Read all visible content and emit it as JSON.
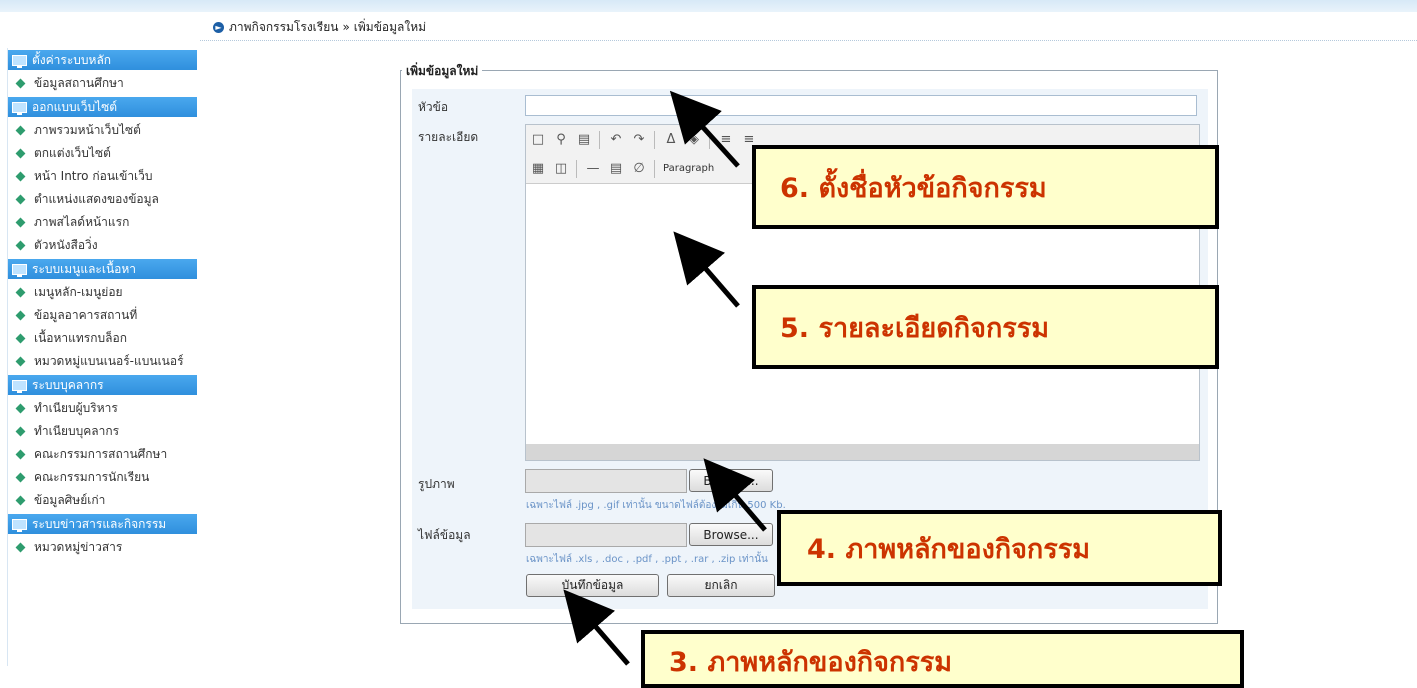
{
  "breadcrumb": {
    "section": "ภาพกิจกรรมโรงเรียน",
    "separator": "»",
    "page": "เพิ่มข้อมูลใหม่"
  },
  "sidebar": {
    "groups": [
      {
        "title": "ตั้งค่าระบบหลัก",
        "items": [
          "ข้อมูลสถานศึกษา"
        ]
      },
      {
        "title": "ออกแบบเว็บไซต์",
        "items": [
          "ภาพรวมหน้าเว็บไซต์",
          "ตกแต่งเว็บไซต์",
          "หน้า Intro ก่อนเข้าเว็บ",
          "ตำแหน่งแสดงของข้อมูล",
          "ภาพสไลด์หน้าแรก",
          "ตัวหนังสือวิ่ง"
        ]
      },
      {
        "title": "ระบบเมนูและเนื้อหา",
        "items": [
          "เมนูหลัก-เมนูย่อย",
          "ข้อมูลอาคารสถานที่",
          "เนื้อหาแทรกบล็อก",
          "หมวดหมู่แบนเนอร์-แบนเนอร์"
        ]
      },
      {
        "title": "ระบบบุคลากร",
        "items": [
          "ทำเนียบผู้บริหาร",
          "ทำเนียบบุคลากร",
          "คณะกรรมการสถานศึกษา",
          "คณะกรรมการนักเรียน",
          "ข้อมูลศิษย์เก่า"
        ]
      },
      {
        "title": "ระบบข่าวสารและกิจกรรม",
        "items": [
          "หมวดหมู่ข่าวสาร"
        ]
      }
    ]
  },
  "form": {
    "legend": "เพิ่มข้อมูลใหม่",
    "title_label": "หัวข้อ",
    "title_value": "",
    "detail_label": "รายละเอียด",
    "toolbar_paragraph": "Paragraph",
    "image_label": "รูปภาพ",
    "image_hint": "เฉพาะไฟล์ .jpg , .gif เท่านั้น ขนาดไฟล์ต้องไม่เกิน 500 Kb.",
    "file_label": "ไฟล์ข้อมูล",
    "file_hint": "เฉพาะไฟล์ .xls , .doc , .pdf , .ppt , .rar , .zip เท่านั้น",
    "browse_label": "Browse...",
    "save_label": "บันทึกข้อมูล",
    "cancel_label": "ยกเลิก"
  },
  "annotations": {
    "title_callout": "6.  ตั้งชื่อหัวข้อกิจกรรม",
    "detail_callout": "5.  รายละเอียดกิจกรรม",
    "image_callout": "4.  ภาพหลักของกิจกรรม",
    "save_callout": "3.  ภาพหลักของกิจกรรม"
  },
  "colors": {
    "sidebar_header": "#2f8fdd",
    "callout_text": "#cc3300",
    "callout_bg": "#ffffcc",
    "hint_text": "#6a93c7"
  }
}
